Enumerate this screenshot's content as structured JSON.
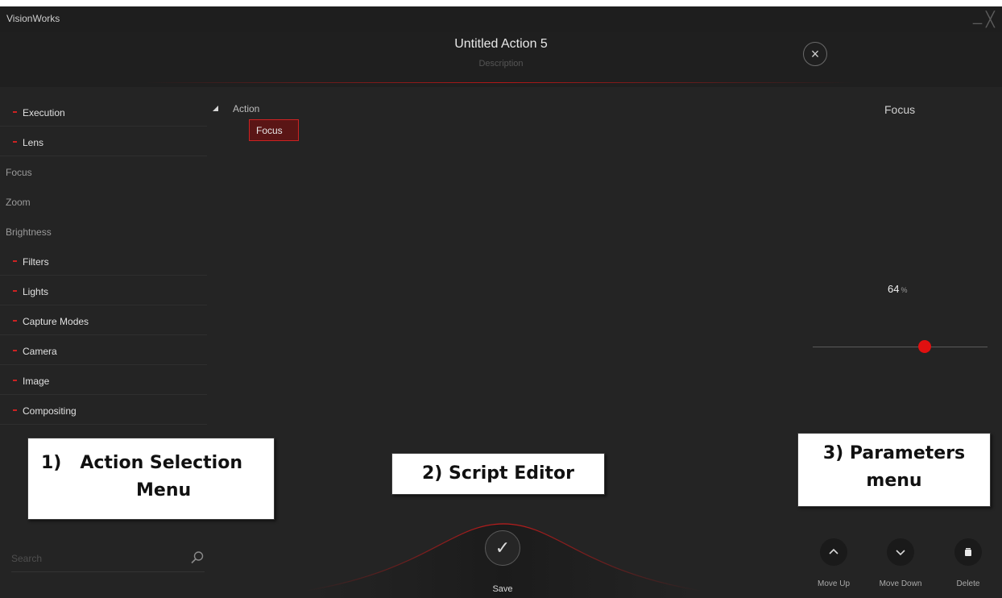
{
  "window": {
    "app_name": "VisionWorks",
    "minimize_glyph": "_",
    "close_glyph": "╳"
  },
  "header": {
    "title": "Untitled Action 5",
    "description_placeholder": "Description",
    "close_icon": "×"
  },
  "menu": {
    "items": [
      {
        "label": "Execution",
        "type": "category"
      },
      {
        "label": "Lens",
        "type": "category"
      },
      {
        "label": "Focus",
        "type": "action"
      },
      {
        "label": "Zoom",
        "type": "action"
      },
      {
        "label": "Brightness",
        "type": "action"
      },
      {
        "label": "Filters",
        "type": "category"
      },
      {
        "label": "Lights",
        "type": "category"
      },
      {
        "label": "Capture Modes",
        "type": "category"
      },
      {
        "label": "Camera",
        "type": "category"
      },
      {
        "label": "Image",
        "type": "category"
      },
      {
        "label": "Compositing",
        "type": "category"
      }
    ]
  },
  "script_editor": {
    "root_label": "Action",
    "selected_node": "Focus"
  },
  "parameters": {
    "title": "Focus",
    "value": "64",
    "unit": "%",
    "slider_fraction": 0.64
  },
  "search": {
    "placeholder": "Search"
  },
  "save": {
    "label": "Save",
    "icon": "✓"
  },
  "bottom_actions": {
    "move_up_label": "Move Up",
    "move_down_label": "Move Down",
    "delete_label": "Delete"
  },
  "annotations": {
    "action_menu_line1": "1)   Action Selection",
    "action_menu_line2": "Menu",
    "script_editor": "2) Script Editor",
    "parameters_line1": "3) Parameters",
    "parameters_line2": "menu"
  },
  "colors": {
    "accent": "#e01010",
    "background": "#242424",
    "selected_node_bg": "#5a1515"
  }
}
